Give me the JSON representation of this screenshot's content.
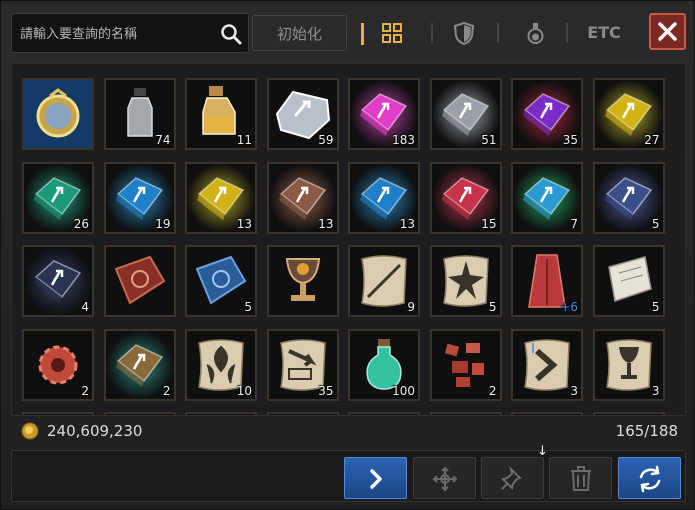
{
  "search": {
    "placeholder": "請輸入要查詢的名稱"
  },
  "toolbar": {
    "reset_label": "初始化",
    "etc_label": "ETC"
  },
  "colors": {
    "accent": "#e5b33f",
    "close_bg": "#7b2a23",
    "active_button": "#2b63b3"
  },
  "items": [
    {
      "icon": "medal-icon",
      "qty": ""
    },
    {
      "icon": "empty-bottle-icon",
      "qty": "74"
    },
    {
      "icon": "potion-bottle-icon",
      "qty": "11"
    },
    {
      "icon": "white-gem-icon",
      "qty": "59"
    },
    {
      "icon": "pink-stone-icon",
      "qty": "183"
    },
    {
      "icon": "silver-stone-icon",
      "qty": "51"
    },
    {
      "icon": "purple-stone-icon",
      "qty": "35"
    },
    {
      "icon": "gold-stone-icon",
      "qty": "27"
    },
    {
      "icon": "green-stone-icon",
      "qty": "26"
    },
    {
      "icon": "blue-stone-icon",
      "qty": "19"
    },
    {
      "icon": "gold-stone-icon",
      "qty": "13"
    },
    {
      "icon": "bronze-stone-icon",
      "qty": "13"
    },
    {
      "icon": "blue-stone-icon",
      "qty": "13"
    },
    {
      "icon": "red-stone-icon",
      "qty": "15"
    },
    {
      "icon": "green-blue-stone-icon",
      "qty": "7"
    },
    {
      "icon": "dark-blue-stone-icon",
      "qty": "5"
    },
    {
      "icon": "black-stone-icon",
      "qty": "4"
    },
    {
      "icon": "red-book-icon",
      "qty": ""
    },
    {
      "icon": "blue-book-icon",
      "qty": "5"
    },
    {
      "icon": "chalice-icon",
      "qty": ""
    },
    {
      "icon": "scroll-sword-icon",
      "qty": "9"
    },
    {
      "icon": "scroll-burst-icon",
      "qty": "5"
    },
    {
      "icon": "red-cape-icon",
      "qty": "+6"
    },
    {
      "icon": "letter-scroll-icon",
      "qty": "5"
    },
    {
      "icon": "red-gear-icon",
      "qty": "2"
    },
    {
      "icon": "rainbow-stone-icon",
      "qty": "2"
    },
    {
      "icon": "scroll-leaf-icon",
      "qty": "10"
    },
    {
      "icon": "scroll-arrow-icon",
      "qty": "35"
    },
    {
      "icon": "green-potion-icon",
      "qty": "100"
    },
    {
      "icon": "red-shards-icon",
      "qty": "2"
    },
    {
      "icon": "scroll-chevron-icon",
      "qty": "3"
    },
    {
      "icon": "scroll-goblet-icon",
      "qty": "3"
    }
  ],
  "gold": {
    "amount": "240,609,230"
  },
  "capacity": {
    "text": "165/188"
  }
}
